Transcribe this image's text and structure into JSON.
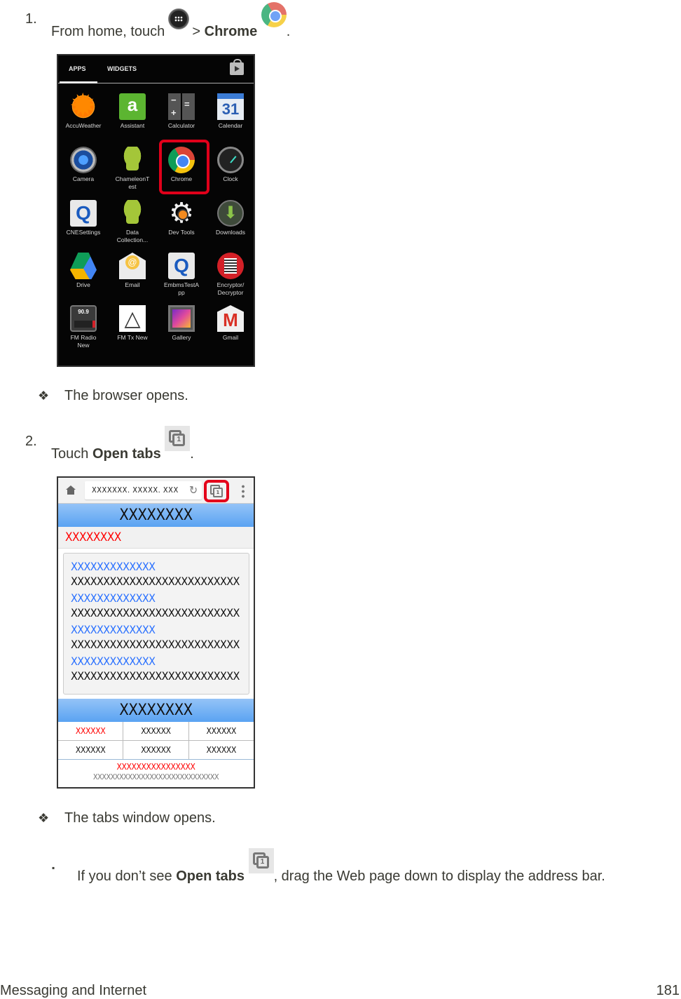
{
  "steps": [
    {
      "number": "1.",
      "text_before": "From home, touch ",
      "icon1": "apps-icon",
      "separator": " > ",
      "bold": "Chrome",
      "icon2": "chrome-icon",
      "text_after": "."
    },
    {
      "number": "2.",
      "text_before": "Touch ",
      "bold": "Open tabs",
      "icon": "open-tabs-icon",
      "text_after": "."
    }
  ],
  "results": [
    {
      "bullet": "❖",
      "text": "The browser opens."
    },
    {
      "bullet": "❖",
      "text": "The tabs window opens."
    }
  ],
  "note": {
    "bullet": "▪",
    "text_before": "If you don’t see ",
    "bold": "Open tabs",
    "icon": "open-tabs-icon",
    "text_after": ", drag the Web page down to display the address bar."
  },
  "app_drawer": {
    "tabs": [
      "APPS",
      "WIDGETS"
    ],
    "active_tab": "APPS",
    "store_icon": "play-store-icon",
    "highlighted_app": "Chrome",
    "highlight_color": "#e0001a",
    "apps": [
      {
        "label": "AccuWeather",
        "icon": "accuweather-icon"
      },
      {
        "label": "Assistant",
        "icon": "assistant-icon"
      },
      {
        "label": "Calculator",
        "icon": "calculator-icon"
      },
      {
        "label": "Calendar",
        "icon": "calendar-icon",
        "glyph": "31"
      },
      {
        "label": "Camera",
        "icon": "camera-icon"
      },
      {
        "label": "ChameleonT\nest",
        "icon": "android-icon"
      },
      {
        "label": "Chrome",
        "icon": "chrome-icon"
      },
      {
        "label": "Clock",
        "icon": "clock-icon"
      },
      {
        "label": "CNESettings",
        "icon": "qualcomm-icon"
      },
      {
        "label": "Data\nCollection...",
        "icon": "android-icon"
      },
      {
        "label": "Dev Tools",
        "icon": "gear-icon"
      },
      {
        "label": "Downloads",
        "icon": "download-icon"
      },
      {
        "label": "Drive",
        "icon": "drive-icon"
      },
      {
        "label": "Email",
        "icon": "email-icon"
      },
      {
        "label": "EmbmsTestA\npp",
        "icon": "qualcomm-icon"
      },
      {
        "label": "Encryptor/\nDecryptor",
        "icon": "encryptor-icon"
      },
      {
        "label": "FM Radio\nNew",
        "icon": "fm-radio-icon",
        "glyph": "90.9"
      },
      {
        "label": "FM Tx New",
        "icon": "fm-tx-icon"
      },
      {
        "label": "Gallery",
        "icon": "gallery-icon"
      },
      {
        "label": "Gmail",
        "icon": "gmail-icon"
      }
    ]
  },
  "browser": {
    "url": "XXXXXXX. XXXXX. XXX",
    "tab_count": "1",
    "highlight_color": "#e4001a",
    "header1": "XXXXXXXX",
    "red_link": "XXXXXXXX",
    "list": [
      {
        "title": "XXXXXXXXXXXXX",
        "desc": "XXXXXXXXXXXXXXXXXXXXXXXXXX"
      },
      {
        "title": "XXXXXXXXXXXXX",
        "desc": "XXXXXXXXXXXXXXXXXXXXXXXXXX"
      },
      {
        "title": "XXXXXXXXXXXXX",
        "desc": "XXXXXXXXXXXXXXXXXXXXXXXXXX"
      },
      {
        "title": "XXXXXXXXXXXXX",
        "desc": "XXXXXXXXXXXXXXXXXXXXXXXXXX"
      }
    ],
    "header2": "XXXXXXXX",
    "grid": [
      [
        "XXXXXX",
        "XXXXXX",
        "XXXXXX"
      ],
      [
        "XXXXXX",
        "XXXXXX",
        "XXXXXX"
      ]
    ],
    "footer_red": "XXXXXXXXXXXXXXXX",
    "footer_gray": "XXXXXXXXXXXXXXXXXXXXXXXXXXXXX",
    "colors": {
      "header_blue": "#5aa3f2",
      "link_blue": "#2970ff",
      "red": "#ff0000"
    }
  },
  "footer": {
    "section": "Messaging and Internet",
    "page": "181"
  }
}
